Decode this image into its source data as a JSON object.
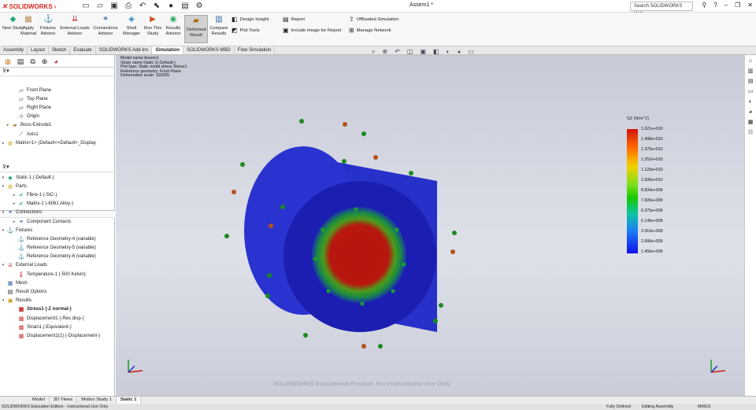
{
  "app": {
    "logo": "SOLIDWORKS",
    "doc_title": "Assem1 *",
    "help_placeholder": "Search SOLIDWORKS Help"
  },
  "ribbon": {
    "buttons": [
      "New Study",
      "Apply Material",
      "Fixtures Advisor",
      "External Loads Advisor",
      "Connections Advisor",
      "Shell Manager",
      "Run This Study",
      "Results Advisor",
      "Deformed Result",
      "Compare Results"
    ],
    "small": [
      "Design Insight",
      "Plot Tools",
      "Report",
      "Include Image for Report",
      "Offloaded Simulation",
      "Manage Network"
    ]
  },
  "tabs": [
    "Assembly",
    "Layout",
    "Sketch",
    "Evaluate",
    "SOLIDWORKS Add-Ins",
    "Simulation",
    "SOLIDWORKS MBD",
    "Flow Simulation"
  ],
  "tree_top": [
    {
      "label": "Front Plane",
      "icon": "plane-icon"
    },
    {
      "label": "Top Plane",
      "icon": "plane-icon"
    },
    {
      "label": "Right Plane",
      "icon": "plane-icon"
    },
    {
      "label": "Origin",
      "icon": "origin-icon"
    },
    {
      "label": "Boss-Extrude1",
      "icon": "extrude-icon"
    },
    {
      "label": "Axis1",
      "icon": "axis-icon"
    },
    {
      "label": "Matrix<1> (Default<<Default>_Display",
      "icon": "part-icon"
    }
  ],
  "sim_tree": [
    "Static 1 (-Default-)",
    "Parts",
    "Fibre-1 (-SiC-)",
    "Matrix-1 (-6061 Alloy-)",
    "Connections",
    "Component Contacts",
    "Fixtures",
    "Reference Geometry-4 (variable)",
    "Reference Geometry-5 (variable)",
    "Reference Geometry-6 (variable)",
    "External Loads",
    "Temperature-1 (-500 Kelvin)",
    "Mesh",
    "Result Options",
    "Results",
    "Stress1 (-Z normal-)",
    "Displacement1 (-Res disp-)",
    "Strain1 (-Equivalent-)",
    "Displacement1(1) (-Displacement-)"
  ],
  "model_info": [
    "Model name:Assem1",
    "Study name:Static 1(-Default-)",
    "Plot type: Static nodal stress Stress1",
    "Reference geometry: Front Plane",
    "Deformation scale: 103055"
  ],
  "legend": {
    "title": "SZ (N/m^2)",
    "labels": [
      "1.621e+010",
      "1.498e+010",
      "1.375e+010",
      "1.252e+010",
      "1.129e+010",
      "1.006e+010",
      "8.834e+009",
      "7.605e+009",
      "6.375e+009",
      "5.145e+009",
      "3.916e+009",
      "2.686e+009",
      "1.456e+009"
    ]
  },
  "watermark": "SOLIDWORKS Educational Product. For Instructional Use Only.",
  "bottom_tabs": [
    "Model",
    "3D Views",
    "Motion Study 1",
    "Static 1"
  ],
  "status": {
    "edition": "SOLIDWORKS Education Edition - Instructional Use Only",
    "defined": "Fully Defined",
    "mode": "Editing Assembly",
    "units": "MMGS"
  }
}
